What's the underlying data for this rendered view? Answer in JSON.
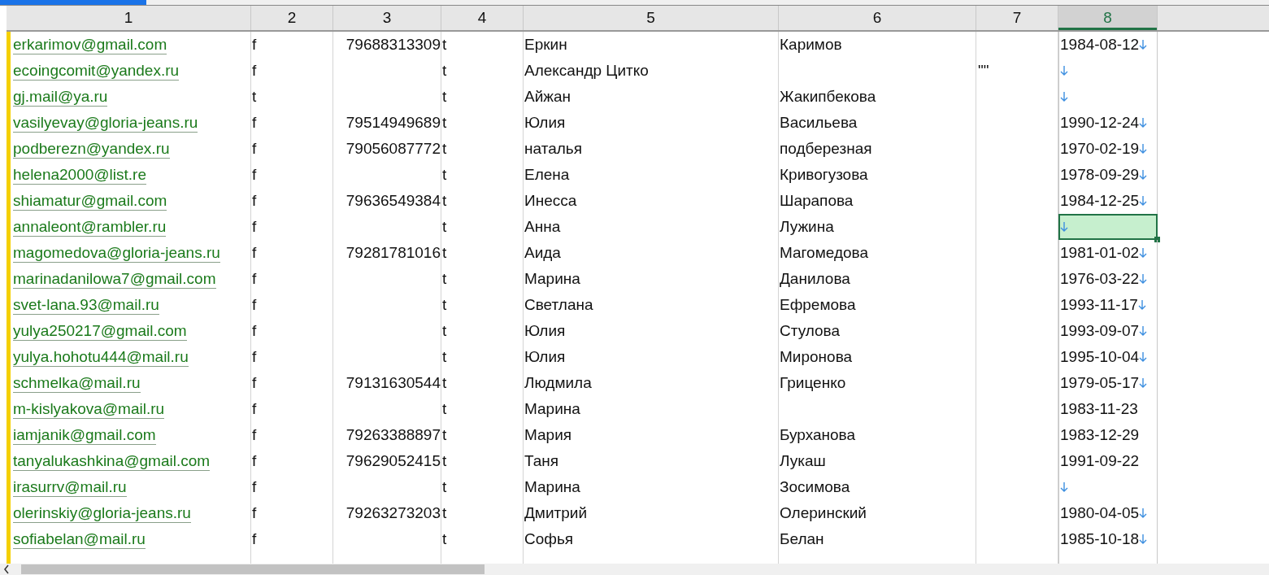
{
  "columns": [
    {
      "label": "1",
      "selected": false
    },
    {
      "label": "2",
      "selected": false
    },
    {
      "label": "3",
      "selected": false
    },
    {
      "label": "4",
      "selected": false
    },
    {
      "label": "5",
      "selected": false
    },
    {
      "label": "6",
      "selected": false
    },
    {
      "label": "7",
      "selected": false
    },
    {
      "label": "8",
      "selected": true
    }
  ],
  "rows": [
    {
      "column_1": "erkarimov@gmail.com",
      "column_2": "f",
      "column_3": "79688313309",
      "column_4": "t",
      "column_5": "Еркин",
      "column_6": "Каримов",
      "column_7": "",
      "column_8": "1984-08-12",
      "line_break": true,
      "selected": false
    },
    {
      "column_1": "ecoingcomit@yandex.ru",
      "column_2": "f",
      "column_3": "",
      "column_4": "t",
      "column_5": "Александр Цитко",
      "column_6": "",
      "column_7": "\"\"",
      "column_8": "",
      "line_break": true,
      "selected": false
    },
    {
      "column_1": "gj.mail@ya.ru",
      "column_2": "t",
      "column_3": "",
      "column_4": "t",
      "column_5": "Айжан",
      "column_6": "Жакипбекова",
      "column_7": "",
      "column_8": "",
      "line_break": true,
      "selected": false
    },
    {
      "column_1": "vasilyevay@gloria-jeans.ru",
      "column_2": "f",
      "column_3": "79514949689",
      "column_4": "t",
      "column_5": "Юлия",
      "column_6": "Васильева",
      "column_7": "",
      "column_8": "1990-12-24",
      "line_break": true,
      "selected": false
    },
    {
      "column_1": "podberezn@yandex.ru",
      "column_2": "f",
      "column_3": "79056087772",
      "column_4": "t",
      "column_5": "наталья",
      "column_6": "подберезная",
      "column_7": "",
      "column_8": "1970-02-19",
      "line_break": true,
      "selected": false
    },
    {
      "column_1": "helena2000@list.re",
      "column_2": "f",
      "column_3": "",
      "column_4": "t",
      "column_5": "Елена",
      "column_6": "Кривогузова",
      "column_7": "",
      "column_8": "1978-09-29",
      "line_break": true,
      "selected": false
    },
    {
      "column_1": "shiamatur@gmail.com",
      "column_2": "f",
      "column_3": "79636549384",
      "column_4": "t",
      "column_5": "Инесса",
      "column_6": "Шарапова",
      "column_7": "",
      "column_8": "1984-12-25",
      "line_break": true,
      "selected": false
    },
    {
      "column_1": "annaleont@rambler.ru",
      "column_2": "f",
      "column_3": "",
      "column_4": "t",
      "column_5": "Анна",
      "column_6": "Лужина",
      "column_7": "",
      "column_8": "",
      "line_break": true,
      "selected": true
    },
    {
      "column_1": "magomedova@gloria-jeans.ru",
      "column_2": "f",
      "column_3": "79281781016",
      "column_4": "t",
      "column_5": "Аида",
      "column_6": "Магомедова",
      "column_7": "",
      "column_8": "1981-01-02",
      "line_break": true,
      "selected": false
    },
    {
      "column_1": "marinadanilowa7@gmail.com",
      "column_2": "f",
      "column_3": "",
      "column_4": "t",
      "column_5": "Марина",
      "column_6": "Данилова",
      "column_7": "",
      "column_8": "1976-03-22",
      "line_break": true,
      "selected": false
    },
    {
      "column_1": "svet-lana.93@mail.ru",
      "column_2": "f",
      "column_3": "",
      "column_4": "t",
      "column_5": "Светлана",
      "column_6": "Ефремова",
      "column_7": "",
      "column_8": "1993-11-17",
      "line_break": true,
      "selected": false
    },
    {
      "column_1": "yulya250217@gmail.com",
      "column_2": "f",
      "column_3": "",
      "column_4": "t",
      "column_5": "Юлия",
      "column_6": "Стулова",
      "column_7": "",
      "column_8": "1993-09-07",
      "line_break": true,
      "selected": false
    },
    {
      "column_1": "yulya.hohotu444@mail.ru",
      "column_2": "f",
      "column_3": "",
      "column_4": "t",
      "column_5": "Юлия",
      "column_6": "Миронова",
      "column_7": "",
      "column_8": "1995-10-04",
      "line_break": true,
      "selected": false
    },
    {
      "column_1": "schmelka@mail.ru",
      "column_2": "f",
      "column_3": "79131630544",
      "column_4": "t",
      "column_5": "Людмила",
      "column_6": "Гриценко",
      "column_7": "",
      "column_8": "1979-05-17",
      "line_break": true,
      "selected": false
    },
    {
      "column_1": "m-kislyakova@mail.ru",
      "column_2": "f",
      "column_3": "",
      "column_4": "t",
      "column_5": "Марина",
      "column_6": "",
      "column_7": "",
      "column_8": "1983-11-23",
      "line_break": false,
      "selected": false
    },
    {
      "column_1": "iamjanik@gmail.com",
      "column_2": "f",
      "column_3": "79263388897",
      "column_4": "t",
      "column_5": "Мария",
      "column_6": "Бурханова",
      "column_7": "",
      "column_8": "1983-12-29",
      "line_break": false,
      "selected": false
    },
    {
      "column_1": "tanyalukashkina@gmail.com",
      "column_2": "f",
      "column_3": "79629052415",
      "column_4": "t",
      "column_5": "Таня",
      "column_6": "Лукаш",
      "column_7": "",
      "column_8": "1991-09-22",
      "line_break": false,
      "selected": false
    },
    {
      "column_1": "irasurrv@mail.ru",
      "column_2": "f",
      "column_3": "",
      "column_4": "t",
      "column_5": "Марина",
      "column_6": "Зосимова",
      "column_7": "",
      "column_8": "",
      "line_break": true,
      "selected": false
    },
    {
      "column_1": "olerinskiy@gloria-jeans.ru",
      "column_2": "f",
      "column_3": "79263273203",
      "column_4": "t",
      "column_5": "Дмитрий",
      "column_6": "Олеринский",
      "column_7": "",
      "column_8": "1980-04-05",
      "line_break": true,
      "selected": false
    },
    {
      "column_1": "sofiabelan@mail.ru",
      "column_2": "f",
      "column_3": "",
      "column_4": "t",
      "column_5": "Софья",
      "column_6": "Белан",
      "column_7": "",
      "column_8": "1985-10-18",
      "line_break": true,
      "selected": false
    }
  ]
}
